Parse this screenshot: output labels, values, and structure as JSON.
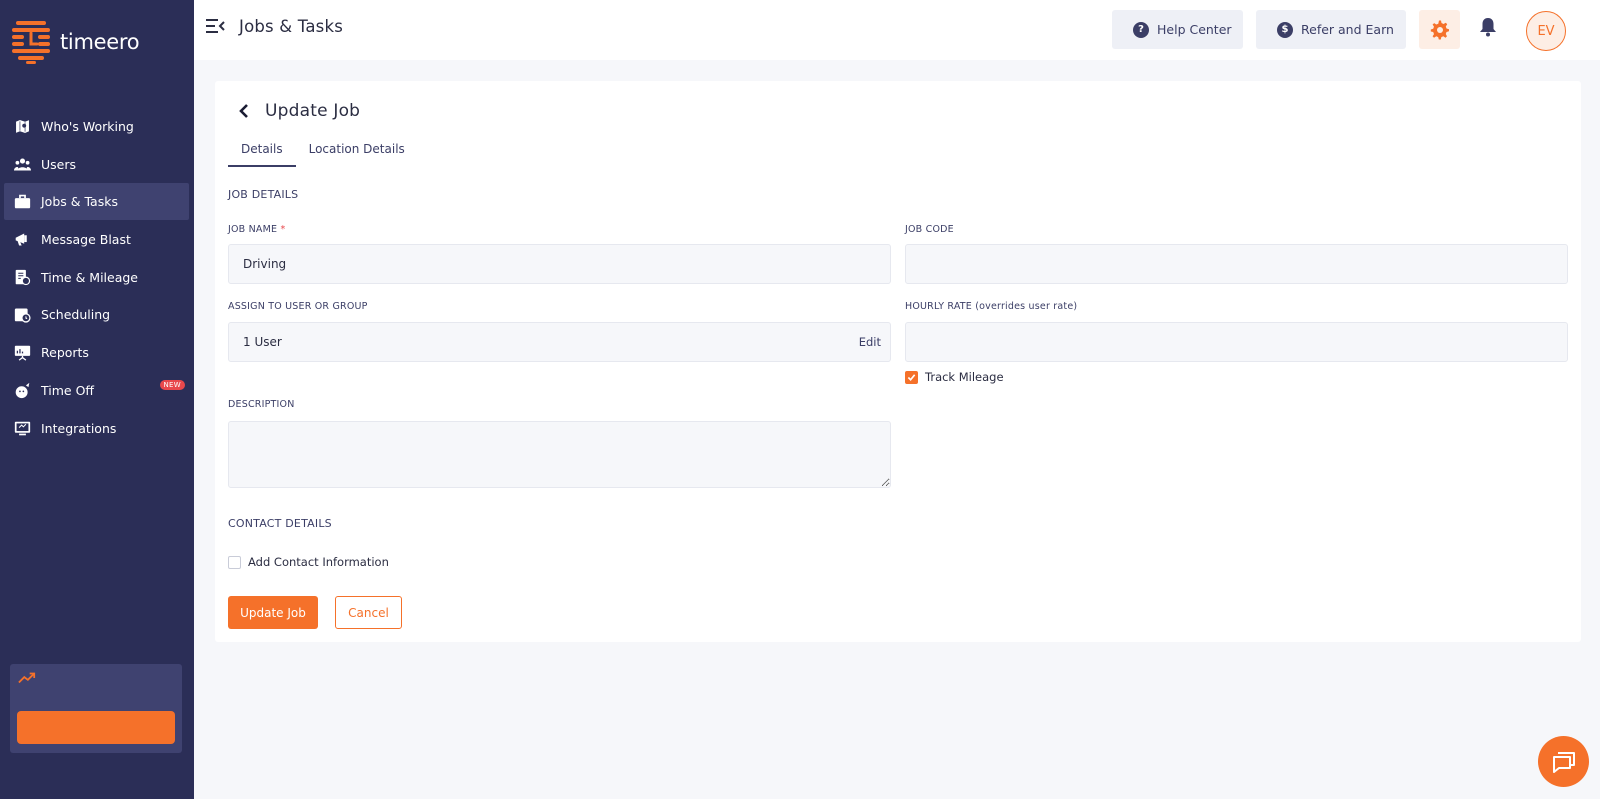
{
  "brand": {
    "name": "timeero",
    "accent": "#f5712a",
    "sidebar_bg": "#2b2e57"
  },
  "sidebar": {
    "items": [
      {
        "label": "Who's Working",
        "icon": "map-icon",
        "active": false
      },
      {
        "label": "Users",
        "icon": "users-icon",
        "active": false
      },
      {
        "label": "Jobs & Tasks",
        "icon": "briefcase-icon",
        "active": true
      },
      {
        "label": "Message Blast",
        "icon": "megaphone-icon",
        "active": false
      },
      {
        "label": "Time & Mileage",
        "icon": "timesheet-icon",
        "active": false
      },
      {
        "label": "Scheduling",
        "icon": "calendar-clock-icon",
        "active": false
      },
      {
        "label": "Reports",
        "icon": "presentation-icon",
        "active": false
      },
      {
        "label": "Time Off",
        "icon": "beach-icon",
        "active": false,
        "badge": "NEW"
      },
      {
        "label": "Integrations",
        "icon": "monitor-icon",
        "active": false
      }
    ]
  },
  "header": {
    "title": "Jobs & Tasks",
    "help_label": "Help Center",
    "refer_label": "Refer and Earn",
    "avatar_initials": "EV"
  },
  "form": {
    "title": "Update Job",
    "tabs": [
      "Details",
      "Location Details"
    ],
    "job_details_heading": "JOB DETAILS",
    "job_name_label": "JOB NAME",
    "job_name_required": "*",
    "job_name_value": "Driving",
    "job_code_label": "JOB CODE",
    "job_code_value": "",
    "assign_label": "ASSIGN TO USER OR GROUP",
    "assign_value": "1 User",
    "assign_edit": "Edit",
    "hourly_rate_label": "HOURLY RATE (overrides user rate)",
    "hourly_rate_value": "",
    "track_mileage_label": "Track Mileage",
    "track_mileage_checked": true,
    "description_label": "DESCRIPTION",
    "description_value": "",
    "contact_heading": "CONTACT DETAILS",
    "add_contact_label": "Add Contact Information",
    "add_contact_checked": false,
    "submit_label": "Update Job",
    "cancel_label": "Cancel"
  }
}
